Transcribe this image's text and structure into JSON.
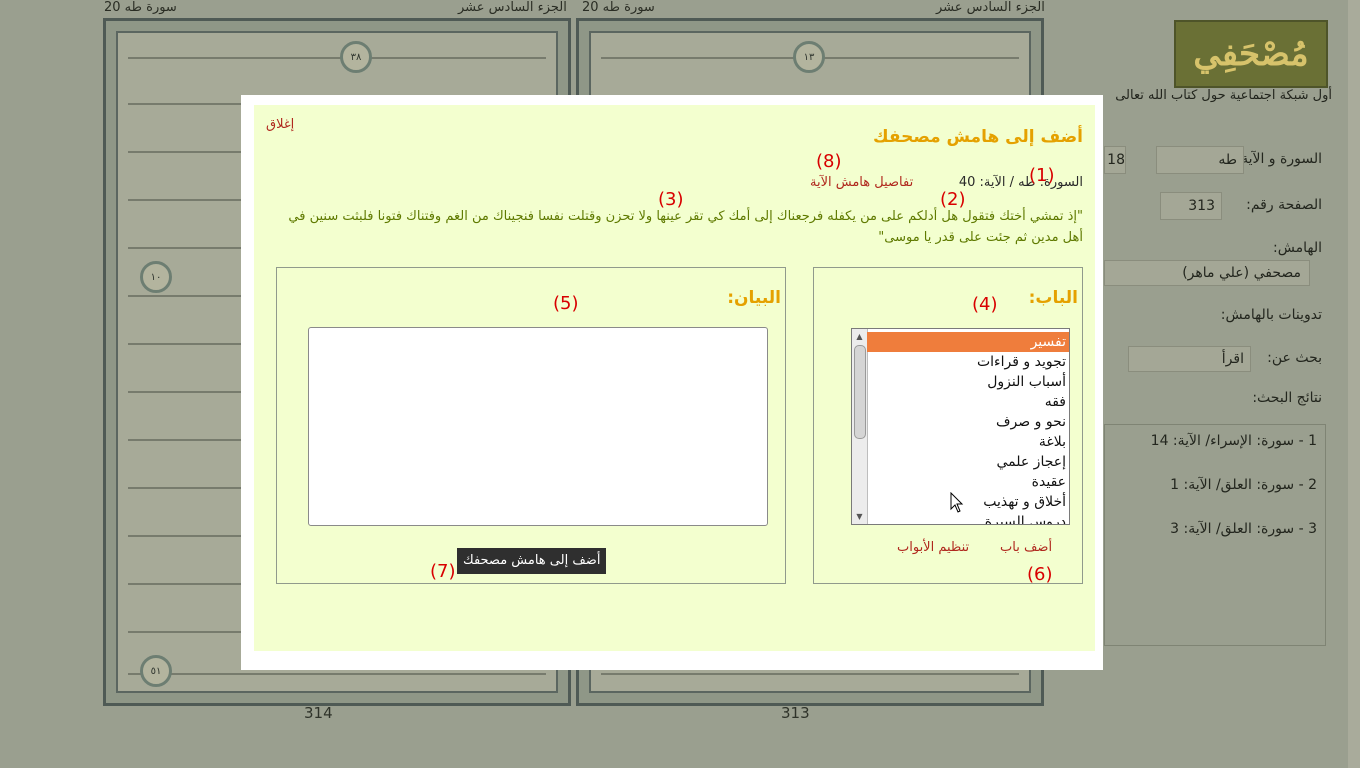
{
  "background": {
    "left_page": {
      "juz": "الجزء السادس عشر",
      "surah": "سورة طه 20",
      "page_number": "314",
      "ayah_markers": [
        "٣٨",
        "١٠",
        "٥١"
      ]
    },
    "right_page": {
      "juz": "الجزء السادس عشر",
      "surah": "سورة طه 20",
      "page_number": "313",
      "ayah_markers": [
        "١٣"
      ]
    },
    "logo": "مُصْحَفِي",
    "tagline": "أول شبكة اجتماعية حول كتاب الله تعالى",
    "sidebar": {
      "surah_ayah_label": "السورة و الآية:",
      "surah_value": "طه",
      "ayah_value": "18",
      "page_label": "الصفحة رقم:",
      "page_value": "313",
      "margin_label": "الهامش:",
      "margin_value": "مصحفي (علي ماهر)",
      "notes_label": "تدوينات بالهامش:",
      "search_label": "بحث عن:",
      "search_value": "اقرأ",
      "results_label": "نتائج البحث:",
      "results": [
        "1 - سورة: الإسراء/ الآية: 14",
        "2 - سورة: العلق/ الآية: 1",
        "3 - سورة: العلق/ الآية: 3"
      ]
    }
  },
  "modal": {
    "close_label": "إغلاق",
    "title": "أضف إلى هامش مصحفك",
    "reference": {
      "surah_label": "السورة:",
      "surah": "طه",
      "ayah_label": "/ الآية:",
      "ayah": "40"
    },
    "details_link": "تفاصيل هامش الآية",
    "ayah_text": "\"إذ تمشي أختك فتقول هل أدلكم على من يكفله فرجعناك إلى أمك كي تقر عينها ولا تحزن وقتلت نفسا فنجيناك من الغم وفتناك فتونا فلبثت سنين في أهل مدين ثم جئت على قدر يا موسى\"",
    "category_panel": {
      "title": "الباب:",
      "items": [
        "تفسير",
        "تجويد و قراءات",
        "أسباب النزول",
        "فقه",
        "نحو و صرف",
        "بلاغة",
        "إعجاز علمي",
        "عقيدة",
        "أخلاق و تهذيب",
        "دروس السيرة"
      ],
      "selected_index": 0,
      "add_link": "أضف باب",
      "organize_link": "تنظيم الأبواب"
    },
    "content_panel": {
      "title": "البيان:",
      "textarea_value": "",
      "submit_label": "أضف إلى هامش مصحفك"
    },
    "annotations": [
      "(1)",
      "(2)",
      "(3)",
      "(4)",
      "(5)",
      "(6)",
      "(7)",
      "(8)"
    ]
  },
  "colors": {
    "accent": "#e5a100",
    "link": "#b0281e",
    "ayah_text": "#5f7a00",
    "selected": "#ef7d3c",
    "modal_bg": "#f3ffcf",
    "annotation": "#d80000"
  }
}
